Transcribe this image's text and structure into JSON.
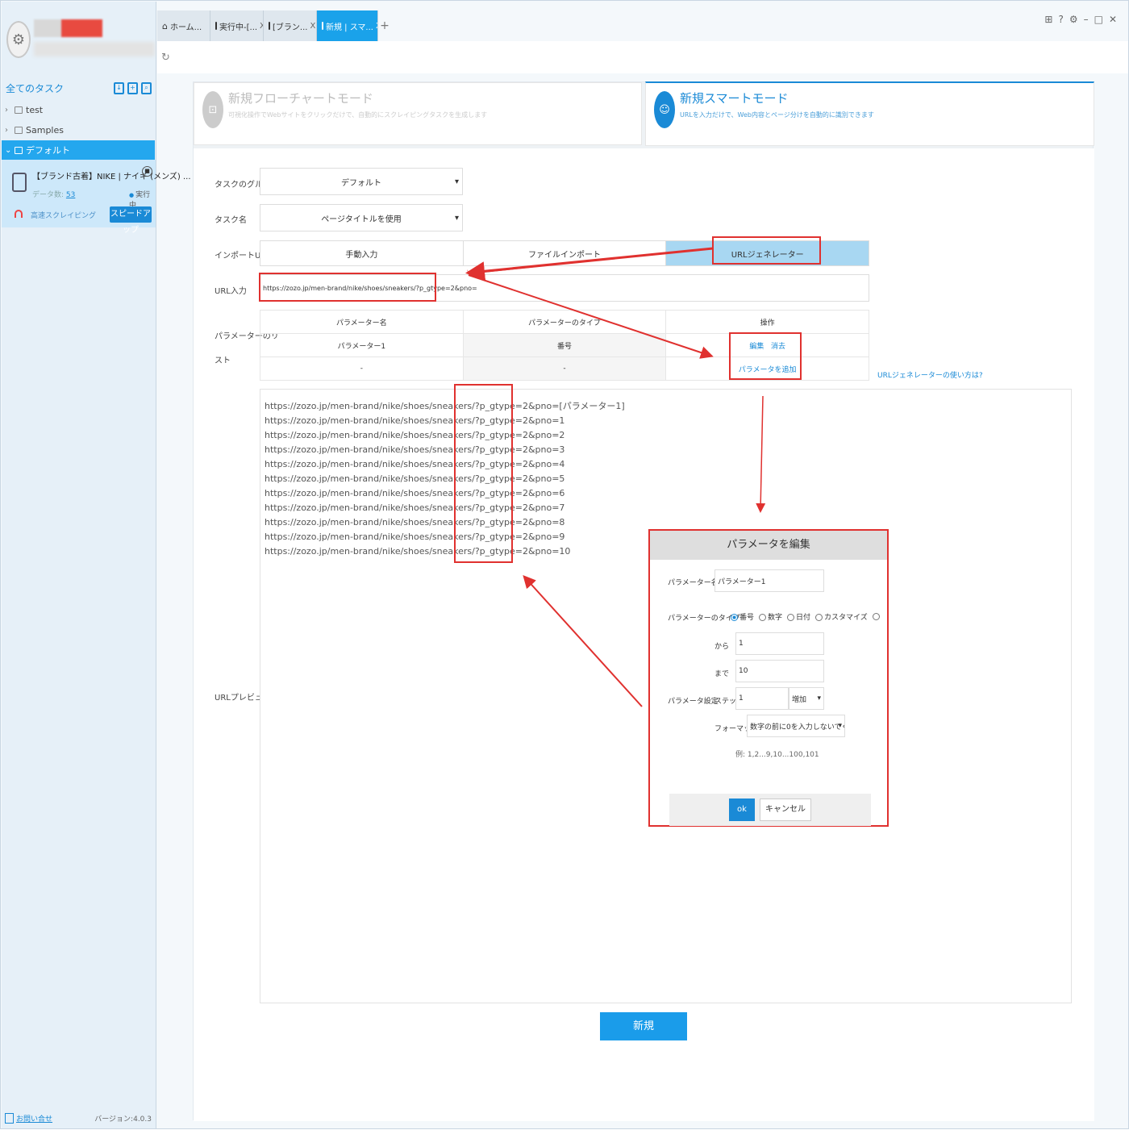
{
  "sidebar": {
    "all_tasks": "全てのタスク",
    "tree": [
      {
        "label": "test"
      },
      {
        "label": "Samples"
      },
      {
        "label": "デフォルト"
      }
    ],
    "task": {
      "title": "【ブランド古着】NIKE | ナイキ (メンズ) ...",
      "data_label": "データ数:",
      "data_count": "53",
      "status": "実行中",
      "mode": "高速スクレイピング",
      "speedup": "スピードアップ"
    },
    "contact": "お問い合せ",
    "version": "バージョン:4.0.3"
  },
  "tabs": [
    {
      "label": "ホーム..."
    },
    {
      "label": "実行中-[..."
    },
    {
      "label": "[ブラン..."
    },
    {
      "label": "新規 | スマ..."
    }
  ],
  "tab_close": "X",
  "tab_add": "+",
  "modes": {
    "flow": {
      "title": "新規フローチャートモード",
      "desc": "可視化操作でWebサイトをクリックだけで、自動的にスクレイピングタスクを生成します"
    },
    "smart": {
      "title": "新規スマートモード",
      "desc": "URLを入力だけで、Web内容とページ分けを自動的に識別できます"
    }
  },
  "form": {
    "group_label": "タスクのグループ",
    "group_value": "デフォルト",
    "name_label": "タスク名",
    "name_value": "ページタイトルを使用",
    "import_label": "インポートURL",
    "import_options": [
      "手動入力",
      "ファイルインポート",
      "URLジェネレーター"
    ],
    "url_label": "URL入力",
    "url_value": "https://zozo.jp/men-brand/nike/shoes/sneakers/?p_gtype=2&pno=",
    "param_list_label_1": "パラメーターのリ",
    "param_list_label_2": "スト",
    "param_headers": [
      "パラメーター名",
      "パラメーターのタイプ",
      "操作"
    ],
    "param_row": {
      "name": "パラメーター1",
      "type": "番号",
      "edit": "編集",
      "delete": "消去"
    },
    "empty_cell": "-",
    "add_param": "パラメータを追加",
    "help_link": "URLジェネレーターの使い方は?",
    "preview_label": "URLプレビュー",
    "preview_urls": [
      "https://zozo.jp/men-brand/nike/shoes/sneakers/?p_gtype=2&pno=[パラメーター1]",
      "https://zozo.jp/men-brand/nike/shoes/sneakers/?p_gtype=2&pno=1",
      "https://zozo.jp/men-brand/nike/shoes/sneakers/?p_gtype=2&pno=2",
      "https://zozo.jp/men-brand/nike/shoes/sneakers/?p_gtype=2&pno=3",
      "https://zozo.jp/men-brand/nike/shoes/sneakers/?p_gtype=2&pno=4",
      "https://zozo.jp/men-brand/nike/shoes/sneakers/?p_gtype=2&pno=5",
      "https://zozo.jp/men-brand/nike/shoes/sneakers/?p_gtype=2&pno=6",
      "https://zozo.jp/men-brand/nike/shoes/sneakers/?p_gtype=2&pno=7",
      "https://zozo.jp/men-brand/nike/shoes/sneakers/?p_gtype=2&pno=8",
      "https://zozo.jp/men-brand/nike/shoes/sneakers/?p_gtype=2&pno=9",
      "https://zozo.jp/men-brand/nike/shoes/sneakers/?p_gtype=2&pno=10"
    ],
    "create": "新規"
  },
  "dialog": {
    "title": "パラメータを編集",
    "name_label": "パラメーター名",
    "name_value": "パラメーター1",
    "type_label": "パラメーターのタイプ",
    "type_options": [
      "番号",
      "数字",
      "日付",
      "カスタマイズ"
    ],
    "from_label": "から",
    "from_value": "1",
    "to_label": "まで",
    "to_value": "10",
    "setting_label": "パラメータ設定",
    "step_label": "ステップ",
    "step_value": "1",
    "step_mode": "増加",
    "format_label": "フォーマット",
    "format_value": "数字の前に0を入力しないでください",
    "example": "例: 1,2...9,10...100,101",
    "ok": "ok",
    "cancel": "キャンセル"
  },
  "colors": {
    "accent": "#1a8ad6",
    "annotation": "#e0312f",
    "active_tab": "#1aa2ea"
  }
}
